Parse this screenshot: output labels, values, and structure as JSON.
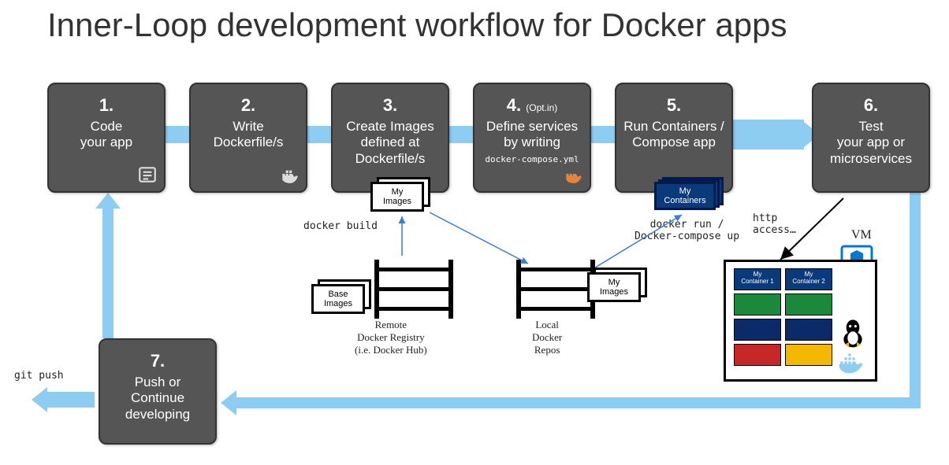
{
  "title": "Inner-Loop development workflow for Docker apps",
  "steps": {
    "s1": {
      "num": "1.",
      "label": "Code\nyour app"
    },
    "s2": {
      "num": "2.",
      "label": "Write\nDockerfile/s"
    },
    "s3": {
      "num": "3.",
      "label": "Create Images defined at Dockerfile/s"
    },
    "s4": {
      "num": "4.",
      "opt": "(Opt.in)",
      "label": "Define services by writing",
      "sub": "docker-compose.yml"
    },
    "s5": {
      "num": "5.",
      "label": "Run Containers / Compose app"
    },
    "s6": {
      "num": "6.",
      "label": "Test\nyour app or microservices"
    },
    "s7": {
      "num": "7.",
      "label": "Push or Continue developing"
    }
  },
  "labels": {
    "docker_build": "docker build",
    "docker_run": "docker run /\nDocker-compose up",
    "http_access": "http\naccess…",
    "vm": "VM",
    "git_push": "git push",
    "remote_registry": "Remote\nDocker Registry\n(i.e. Docker Hub)",
    "local_repos": "Local\nDocker\nRepos",
    "base_images": "Base\nImages",
    "my_images": "My\nImages",
    "my_images2": "My\nImages",
    "my_containers": "My\nContainers",
    "my_container1": "My\nContainer 1",
    "my_container2": "My\nContainer 2"
  }
}
